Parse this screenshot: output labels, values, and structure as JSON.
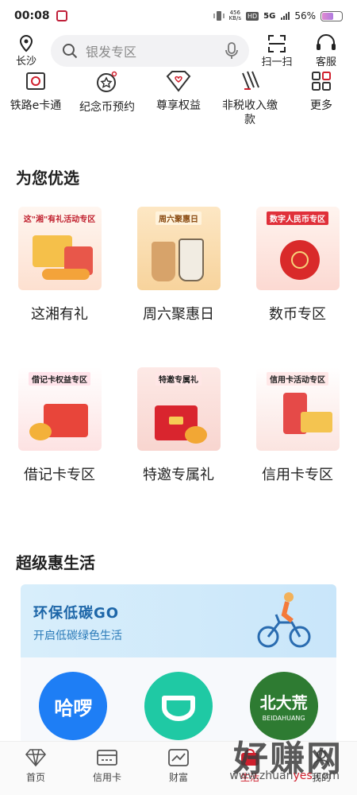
{
  "status_bar": {
    "time": "00:08",
    "net_speed_top": "456",
    "net_speed_bottom": "KB/s",
    "hd": "HD",
    "signal": "5G",
    "battery": "56%"
  },
  "header": {
    "location": "长沙",
    "search_placeholder": "银发专区",
    "scan": "扫一扫",
    "service": "客服"
  },
  "quick_items": [
    {
      "label": "铁路e卡通"
    },
    {
      "label": "纪念币预约"
    },
    {
      "label": "尊享权益"
    },
    {
      "label": "非税收入缴款"
    },
    {
      "label": "更多"
    }
  ],
  "section_preferred": "为您优选",
  "promos_row1": [
    {
      "tag": "这\"湘\"有礼活动专区",
      "label": "这湘有礼"
    },
    {
      "tag": "周六聚惠日",
      "label": "周六聚惠日"
    },
    {
      "tag": "数字人民币专区",
      "label": "数币专区"
    }
  ],
  "promos_row2": [
    {
      "tag": "借记卡权益专区",
      "label": "借记卡专区"
    },
    {
      "tag": "特邀专属礼",
      "label": "特邀专属礼"
    },
    {
      "tag": "信用卡活动专区",
      "label": "信用卡专区"
    }
  ],
  "section_life": "超级惠生活",
  "life_banner": {
    "title": "环保低碳GO",
    "subtitle": "开启低碳绿色生活"
  },
  "apps": [
    {
      "name": "哈啰",
      "color": "#1e7ef5"
    },
    {
      "name": "",
      "color": "#1fc9a4"
    },
    {
      "name": "北大荒",
      "brand": "BEIDAHUANG",
      "color": "#2e7b32"
    }
  ],
  "bottom_nav": [
    {
      "label": "首页"
    },
    {
      "label": "信用卡"
    },
    {
      "label": "财富"
    },
    {
      "label": "生活",
      "active": true
    },
    {
      "label": "我的"
    }
  ],
  "watermark": {
    "text": "好赚网",
    "url_pre": "www.zhuan",
    "url_red": "yes",
    "url_post": ".com"
  },
  "colors": {
    "accent": "#d0202e",
    "banner_blue": "#1d66a8"
  }
}
